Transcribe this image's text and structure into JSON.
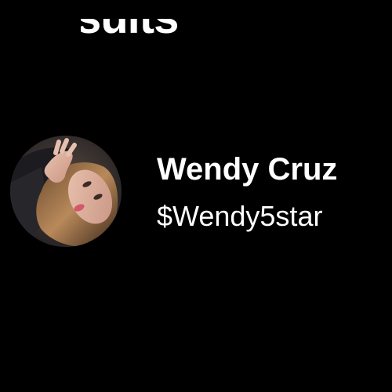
{
  "header": {
    "title": "sults"
  },
  "result": {
    "display_name": "Wendy Cruz",
    "cashtag": "$Wendy5star",
    "avatar": "profile-photo"
  },
  "colors": {
    "background": "#000000",
    "text": "#ffffff"
  }
}
